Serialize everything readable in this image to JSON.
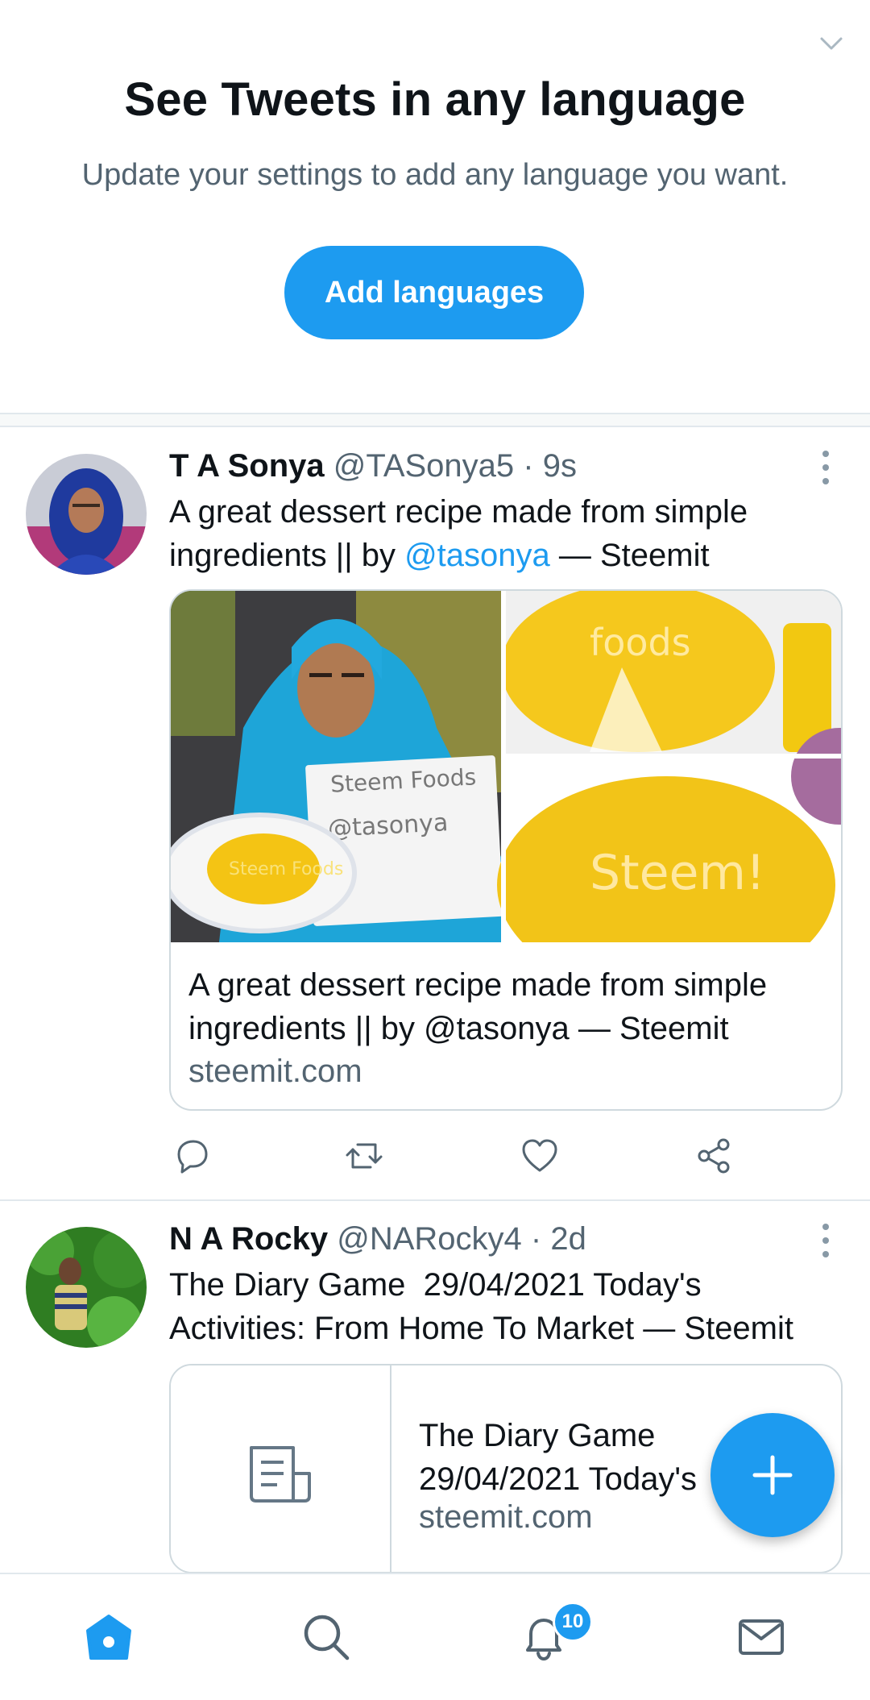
{
  "language_prompt": {
    "title": "See Tweets in any language",
    "subtitle": "Update your settings to add any language you want.",
    "button_label": "Add languages"
  },
  "tweets": [
    {
      "name": "T A Sonya",
      "handle": "@TASonya5",
      "time": "9s",
      "text_before": "A great dessert recipe made from simple ingredients || by ",
      "mention": "@tasonya",
      "text_after": " — Steemit",
      "card": {
        "title": "A great dessert recipe made from simple ingredients || by @tasonya — Steemit",
        "domain": "steemit.com",
        "sign_line1": "Steem Foods",
        "sign_line2": "@tasonya",
        "image_text_1": "foods",
        "image_text_2": "Steem!",
        "plate_text": "Steem Foods"
      }
    },
    {
      "name": "N A Rocky",
      "handle": "@NARocky4",
      "time": "2d",
      "text": "The Diary Game  29/04/2021 Today's Activities: From Home To Market — Steemit",
      "card": {
        "title_line1": "The Diary Game",
        "title_line2": "29/04/2021 Today's",
        "domain": "steemit.com"
      }
    }
  ],
  "nav": {
    "items": [
      "home-icon",
      "search-icon",
      "bell-icon",
      "mail-icon"
    ],
    "notification_count": "10"
  },
  "colors": {
    "accent": "#1d9bf0",
    "text": "#0f1419",
    "secondary": "#536471",
    "divider": "#e1e8ed"
  }
}
